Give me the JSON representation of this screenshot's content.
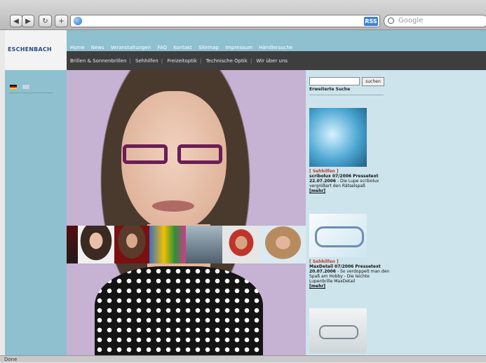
{
  "browser": {
    "rss_label": "RSS",
    "search_placeholder": "Google"
  },
  "site": {
    "logo_text": "ESCHENBACH"
  },
  "top_nav": {
    "items": [
      "Home",
      "News",
      "Veranstaltungen",
      "FAQ",
      "Kontakt",
      "Sitemap",
      "Impressum",
      "Händlersuche"
    ]
  },
  "sub_nav": {
    "items": [
      "Brillen & Sonnenbrillen",
      "Sehhilfen",
      "Freizeitoptik",
      "Technische Optik",
      "Wir über uns"
    ]
  },
  "search": {
    "button": "suchen",
    "advanced": "Erweiterte Suche"
  },
  "news": [
    {
      "category": "[ Sehhilfen ]",
      "title": "scribolux 07/2006 Pressetext",
      "date": "22.07.2006",
      "text": " - Die Lupe scribolux vergrößert den Rätselspaß",
      "more": "[mehr]"
    },
    {
      "category": "[ Sehhilfen ]",
      "title": "MaxDetail 07/2006 Pressetext",
      "date": "20.07.2006",
      "text": " - So verdoppelt man den Spaß am Hobby - Die leichte Lupenbrille MaxDetail",
      "more": "[mehr]"
    }
  ],
  "status": {
    "text": "Done"
  },
  "colors": {
    "nav_bg": "#8ec0cf",
    "subnav_bg": "#3e3e3e",
    "content_bg": "#cde4ec",
    "accent_red": "#c0392b"
  }
}
